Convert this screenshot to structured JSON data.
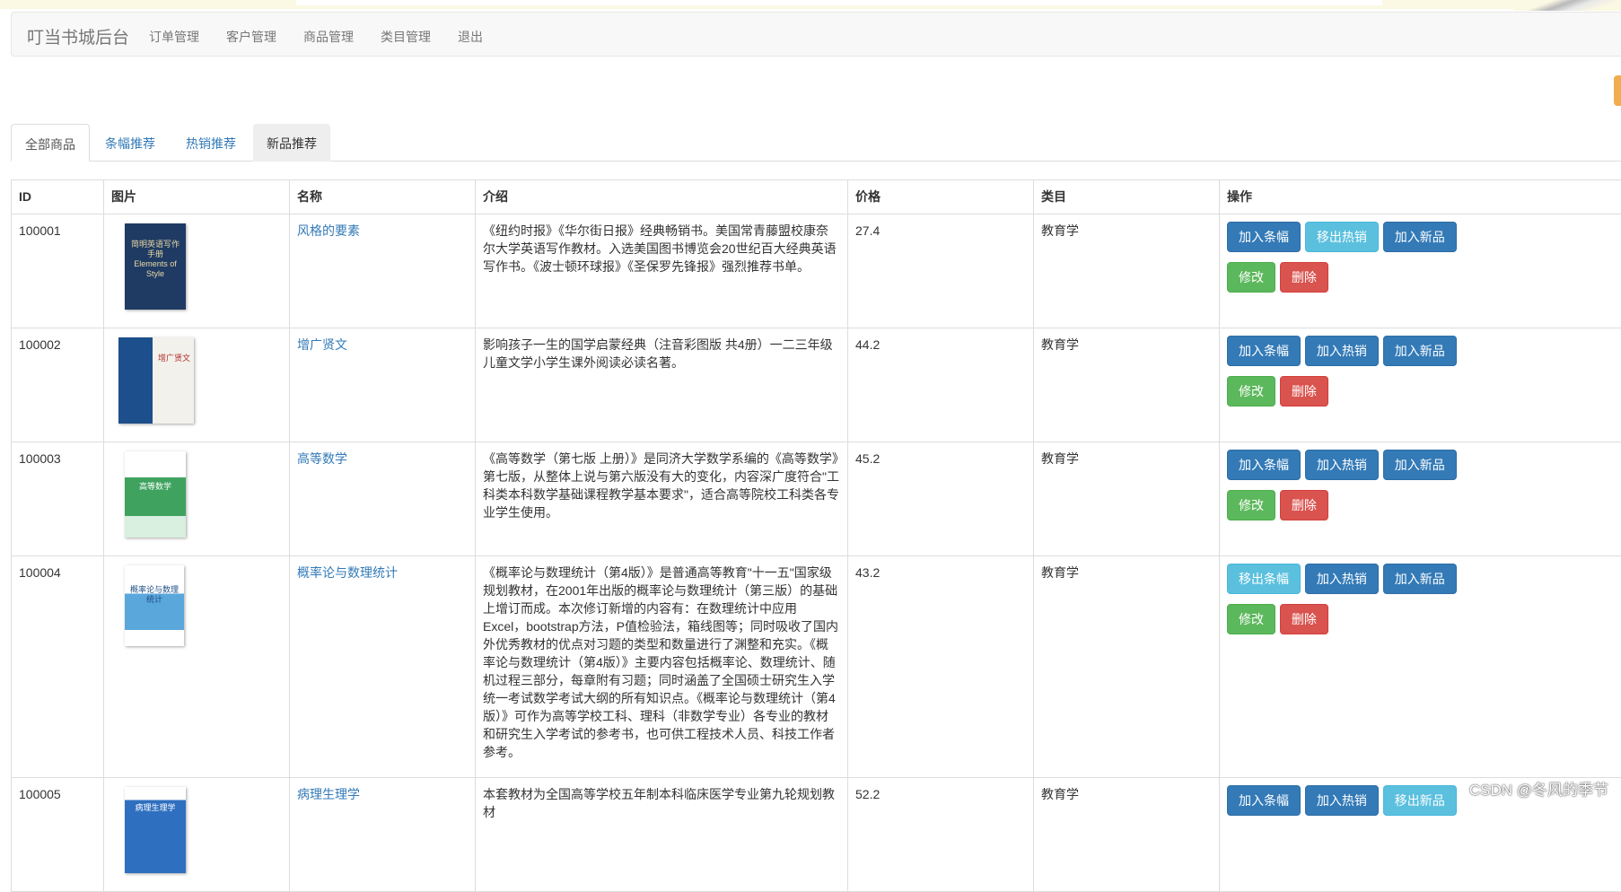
{
  "nav": {
    "brand": "叮当书城后台",
    "links": [
      "订单管理",
      "客户管理",
      "商品管理",
      "类目管理",
      "退出"
    ]
  },
  "tabs": [
    "全部商品",
    "条幅推荐",
    "热销推荐",
    "新品推荐"
  ],
  "table": {
    "headers": [
      "ID",
      "图片",
      "名称",
      "介绍",
      "价格",
      "类目",
      "操作"
    ],
    "rows": [
      {
        "id": "100001",
        "cover_title": "简明英语写作手册 Elements of Style",
        "name": "风格的要素",
        "intro": "《纽约时报》《华尔街日报》经典畅销书。美国常青藤盟校康奈尔大学英语写作教材。入选美国图书博览会20世纪百大经典英语写作书。《波士顿环球报》《圣保罗先锋报》强烈推荐书单。",
        "price": "27.4",
        "category": "教育学",
        "buttons": [
          "加入条幅",
          "移出热销",
          "加入新品",
          "修改",
          "删除"
        ]
      },
      {
        "id": "100002",
        "cover_title": "增广贤文",
        "name": "增广贤文",
        "intro": "影响孩子一生的国学启蒙经典（注音彩图版 共4册）一二三年级儿童文学小学生课外阅读必读名著。",
        "price": "44.2",
        "category": "教育学",
        "buttons": [
          "加入条幅",
          "加入热销",
          "加入新品",
          "修改",
          "删除"
        ]
      },
      {
        "id": "100003",
        "cover_title": "高等数学",
        "name": "高等数学",
        "intro": "《高等数学（第七版 上册）》是同济大学数学系编的《高等数学》第七版，从整体上说与第六版没有大的变化，内容深广度符合\"工科类本科数学基础课程教学基本要求\"，适合高等院校工科类各专业学生使用。",
        "price": "45.2",
        "category": "教育学",
        "buttons": [
          "加入条幅",
          "加入热销",
          "加入新品",
          "修改",
          "删除"
        ]
      },
      {
        "id": "100004",
        "cover_title": "概率论与数理统计",
        "name": "概率论与数理统计",
        "intro": "《概率论与数理统计（第4版）》是普通高等教育\"十一五\"国家级规划教材，在2001年出版的概率论与数理统计（第三版）的基础上增订而成。本次修订新增的内容有：在数理统计中应用Excel，bootstrap方法，P值检验法，箱线图等；同时吸收了国内外优秀教材的优点对习题的类型和数量进行了渊整和充实。《概率论与数理统计（第4版）》主要内容包括概率论、数理统计、随机过程三部分，每章附有习题；同时涵盖了全国硕士研究生入学统一考试数学考试大纲的所有知识点。《概率论与数理统计（第4版）》可作为高等学校工科、理科（非数学专业）各专业的教材和研究生入学考试的参考书，也可供工程技术人员、科技工作者参考。",
        "price": "43.2",
        "category": "教育学",
        "buttons": [
          "移出条幅",
          "加入热销",
          "加入新品",
          "修改",
          "删除"
        ]
      },
      {
        "id": "100005",
        "cover_title": "病理生理学",
        "name": "病理生理学",
        "intro": "本套教材为全国高等学校五年制本科临床医学专业第九轮规划教材",
        "price": "52.2",
        "category": "教育学",
        "buttons": [
          "加入条幅",
          "加入热销",
          "移出新品"
        ]
      }
    ]
  },
  "watermark": "CSDN @冬风的季节",
  "colors": {
    "primary": "#337ab7",
    "info": "#5bc0de",
    "success": "#5cb85c",
    "danger": "#d9534f"
  }
}
